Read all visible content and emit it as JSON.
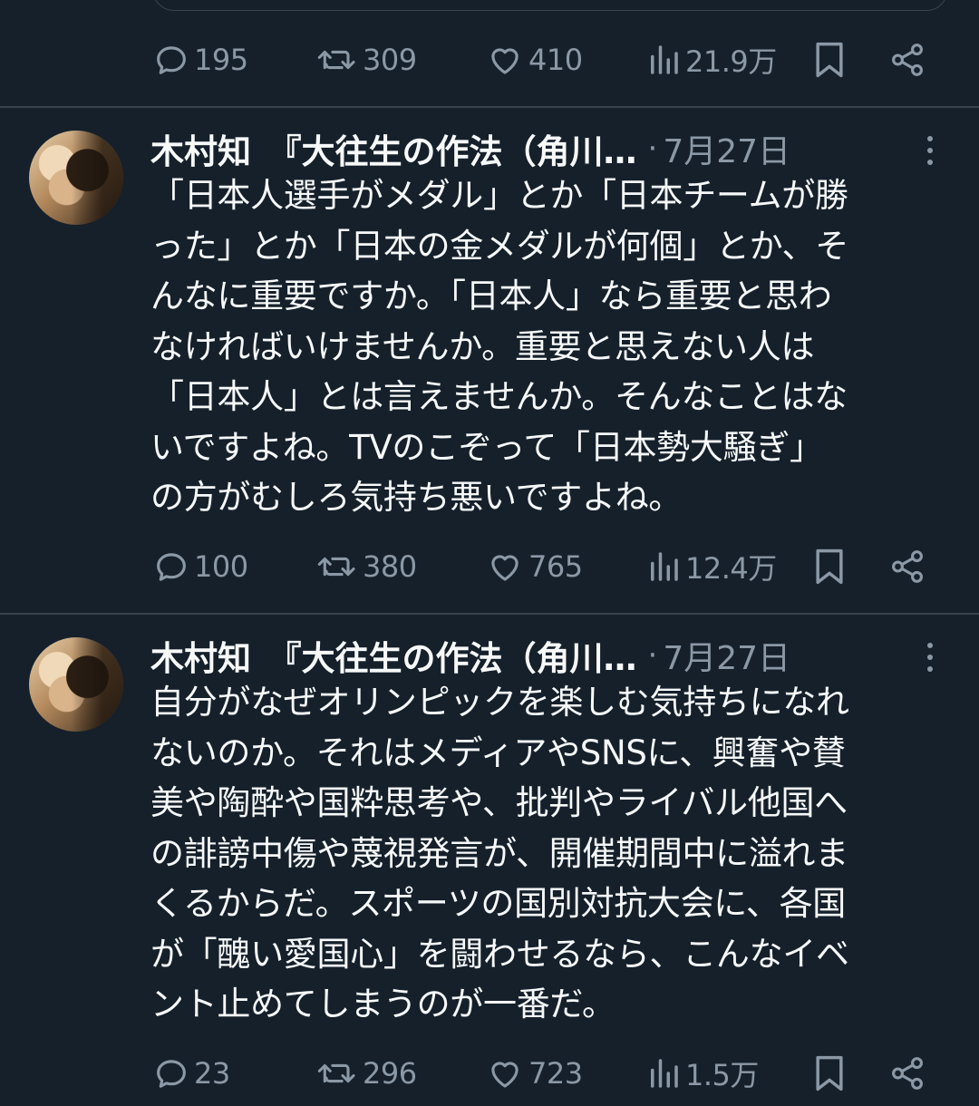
{
  "top_action_bar": {
    "reply_count": "195",
    "retweet_count": "309",
    "like_count": "410",
    "view_count": "21.9万"
  },
  "tweets": [
    {
      "author": "木村知　『大往生の作法（角川…",
      "separator": "·",
      "date": "7月27日",
      "text": "「日本人選手がメダル」とか「日本チームが勝\nった」とか「日本の金メダルが何個」とか、そ\nんなに重要ですか。「日本人」なら重要と思わ\nなければいけませんか。重要と思えない人は\n「日本人」とは言えませんか。そんなことはな\nいですよね。TVのこぞって「日本勢大騒ぎ」\nの方がむしろ気持ち悪いですよね。",
      "reply_count": "100",
      "retweet_count": "380",
      "like_count": "765",
      "view_count": "12.4万"
    },
    {
      "author": "木村知　『大往生の作法（角川…",
      "separator": "·",
      "date": "7月27日",
      "text": "自分がなぜオリンピックを楽しむ気持ちになれ\nないのか。それはメディアやSNSに、興奮や賛\n美や陶酔や国粋思考や、批判やライバル他国へ\nの誹謗中傷や蔑視発言が、開催期間中に溢れま\nくるからだ。スポーツの国別対抗大会に、各国\nが「醜い愛国心」を闘わせるなら、こんなイベ\nント止めてしまうのが一番だ。",
      "reply_count": "23",
      "retweet_count": "296",
      "like_count": "723",
      "view_count": "1.5万"
    }
  ],
  "icons": {
    "reply": "reply-icon",
    "retweet": "retweet-icon",
    "like": "heart-icon",
    "views": "views-icon",
    "bookmark": "bookmark-icon",
    "share": "share-icon",
    "more": "more-icon"
  },
  "colors": {
    "background": "#15202b",
    "text": "#f7f9f9",
    "muted": "#8b98a5",
    "divider": "#38444d"
  }
}
